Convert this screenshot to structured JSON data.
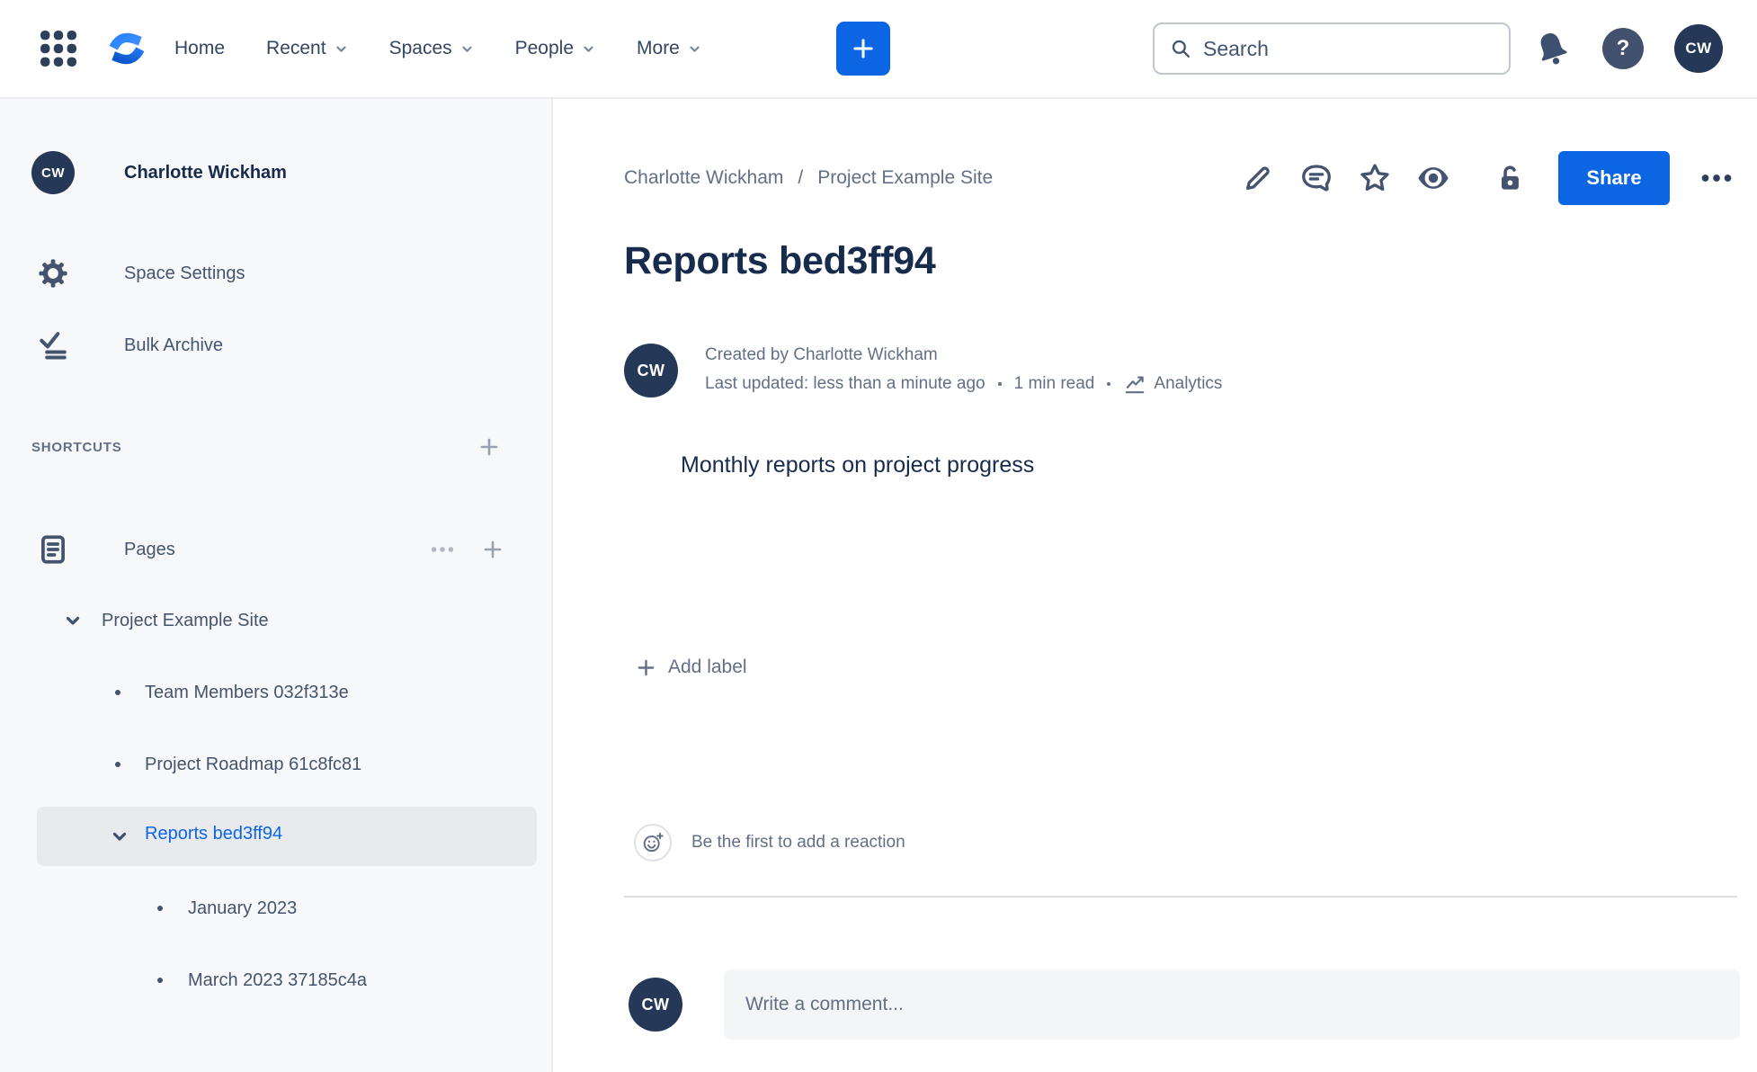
{
  "topbar": {
    "nav": [
      {
        "label": "Home",
        "has_menu": false
      },
      {
        "label": "Recent",
        "has_menu": true
      },
      {
        "label": "Spaces",
        "has_menu": true
      },
      {
        "label": "People",
        "has_menu": true
      },
      {
        "label": "More",
        "has_menu": true
      }
    ],
    "search_placeholder": "Search",
    "avatar_initials": "CW"
  },
  "sidebar": {
    "profile": {
      "initials": "CW",
      "name": "Charlotte Wickham"
    },
    "menu": [
      {
        "label": "Space Settings"
      },
      {
        "label": "Bulk Archive"
      }
    ],
    "shortcuts_heading": "SHORTCUTS",
    "pages_label": "Pages",
    "tree": {
      "root_label": "Project Example Site",
      "children": [
        {
          "label": "Team Members 032f313e"
        },
        {
          "label": "Project Roadmap 61c8fc81"
        }
      ],
      "selected_label": "Reports bed3ff94",
      "selected_children": [
        {
          "label": "January 2023"
        },
        {
          "label": "March 2023 37185c4a"
        }
      ]
    }
  },
  "main": {
    "breadcrumb": {
      "item1": "Charlotte Wickham",
      "separator": "/",
      "item2": "Project Example Site"
    },
    "share_label": "Share",
    "title": "Reports bed3ff94",
    "byline": {
      "initials": "CW",
      "created": "Created by Charlotte Wickham",
      "updated": "Last updated: less than a minute ago",
      "read_time": "1 min read",
      "analytics_label": "Analytics"
    },
    "body_text": "Monthly reports on project progress",
    "add_label_text": "Add label",
    "reaction_prompt": "Be the first to add a reaction",
    "comment_placeholder": "Write a comment..."
  },
  "icons": {
    "help_glyph": "?"
  },
  "colors": {
    "accent_blue": "#0C66E4",
    "navy_text": "#172B4D",
    "slate_icon": "#44546F",
    "gray_text": "#626F86",
    "avatar_navy": "#253858",
    "sidebar_bg": "#F7F8F9",
    "selected_row_bg": "#E9EAEE",
    "border": "#EBECF0"
  }
}
